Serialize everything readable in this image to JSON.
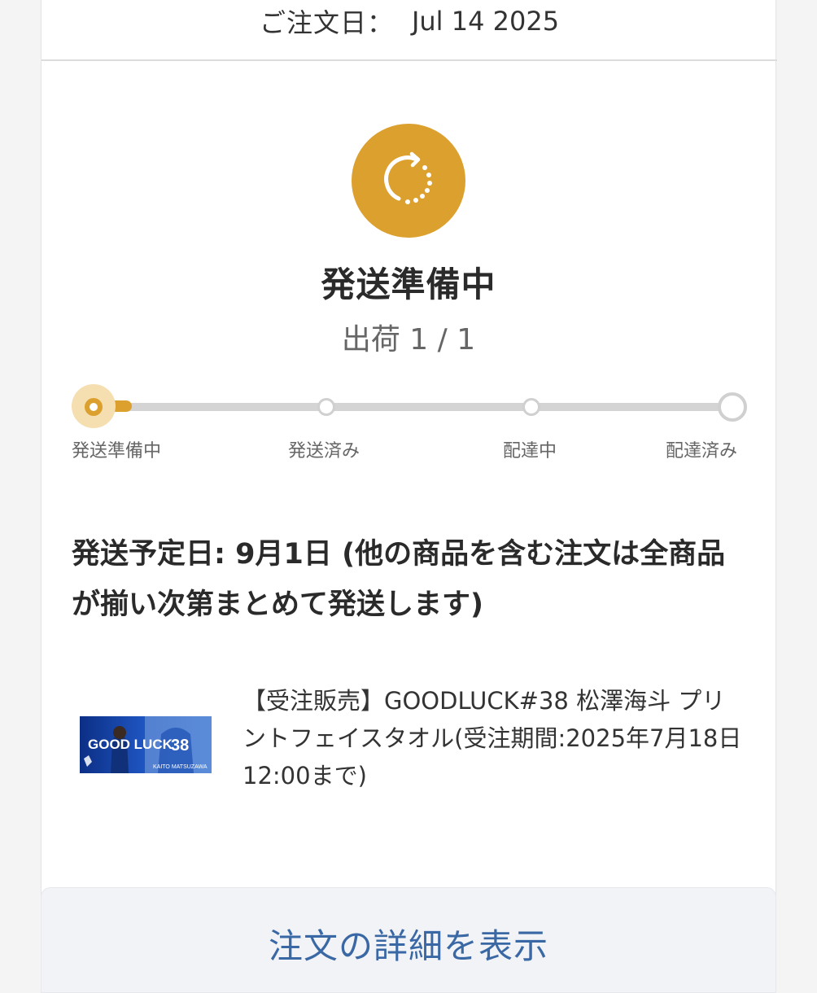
{
  "order": {
    "date_label": "ご注文日：",
    "date_value": "Jul 14 2025"
  },
  "status": {
    "icon": "refresh-icon",
    "color": "#dca02e",
    "title": "発送準備中",
    "shipment": "出荷 1 / 1"
  },
  "progress": {
    "current_step": 1,
    "total_steps": 4,
    "steps": [
      "発送準備中",
      "発送済み",
      "配達中",
      "配達済み"
    ]
  },
  "shipping_note": "発送予定日: 9月1日 (他の商品を含む注文は全商品が揃い次第まとめて発送します)",
  "product": {
    "name": "【受注販売】GOODLUCK#38 松澤海斗 プリントフェイスタオル(受注期間:2025年7月18日12:00まで)",
    "thumb_text": "GOOD LUCK",
    "thumb_number": "38",
    "thumb_player": "KAITO MATSUZAWA"
  },
  "detail_button": "注文の詳細を表示"
}
